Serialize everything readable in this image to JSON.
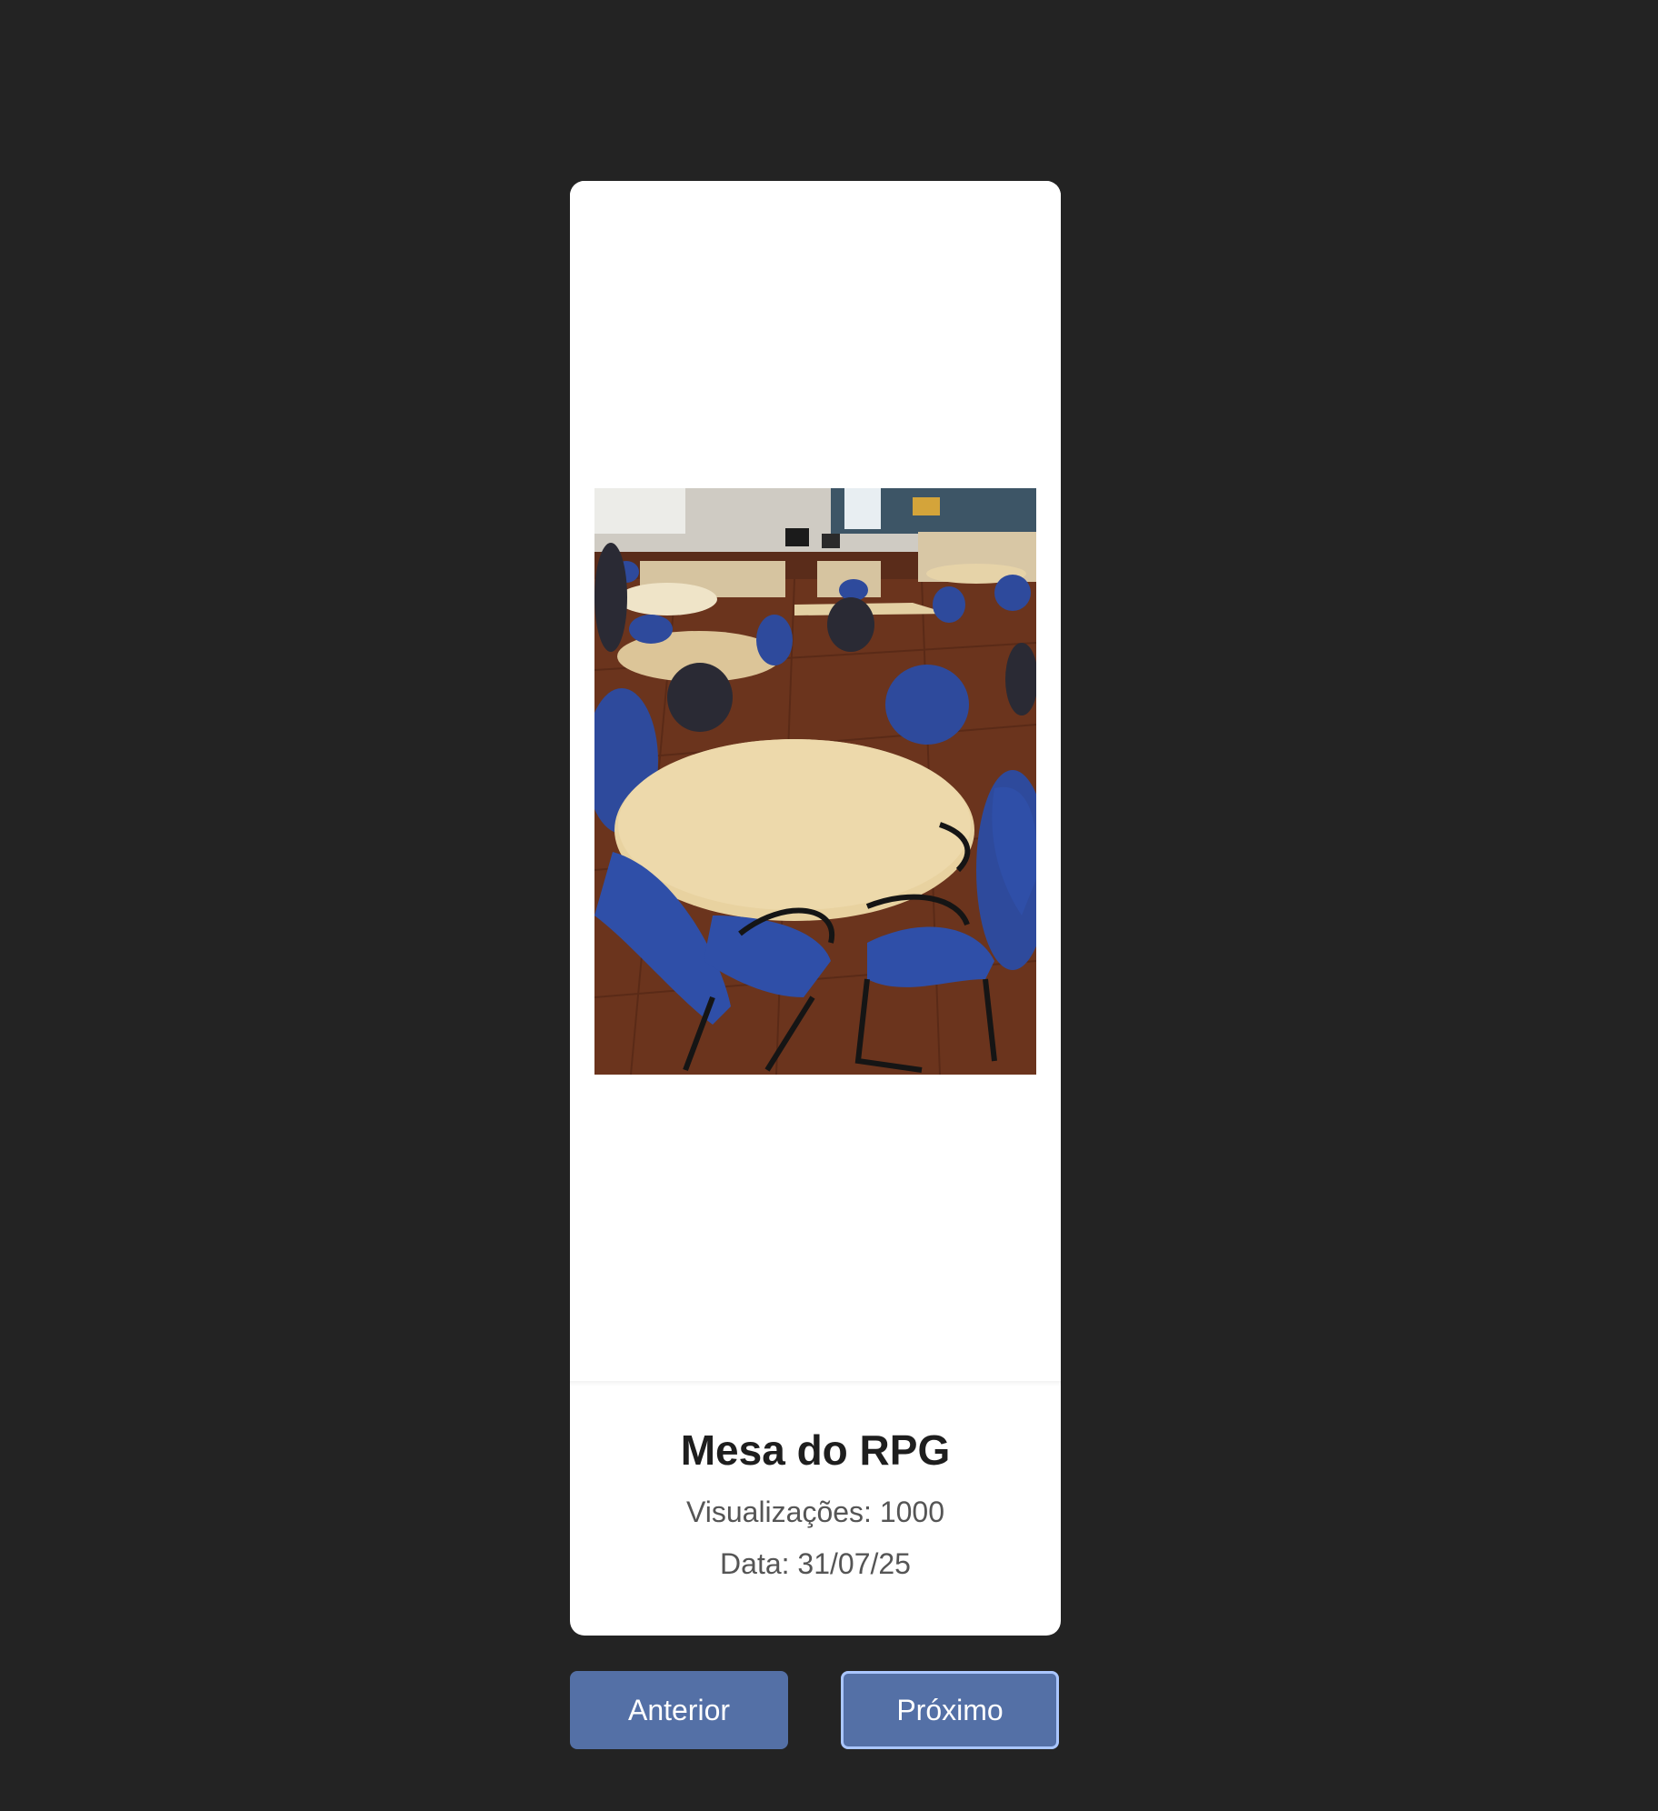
{
  "card": {
    "image": {
      "alt": "Mesa do RPG",
      "icon": "photo-icon"
    },
    "title": "Mesa do RPG",
    "views": "Visualizações: 1000",
    "date": "Data: 31/07/25"
  },
  "navigation": {
    "prev_label": "Anterior",
    "next_label": "Próximo"
  },
  "colors": {
    "background": "#232323",
    "card": "#ffffff",
    "button": "#5470a6",
    "focus_ring": "#aac6ff"
  }
}
